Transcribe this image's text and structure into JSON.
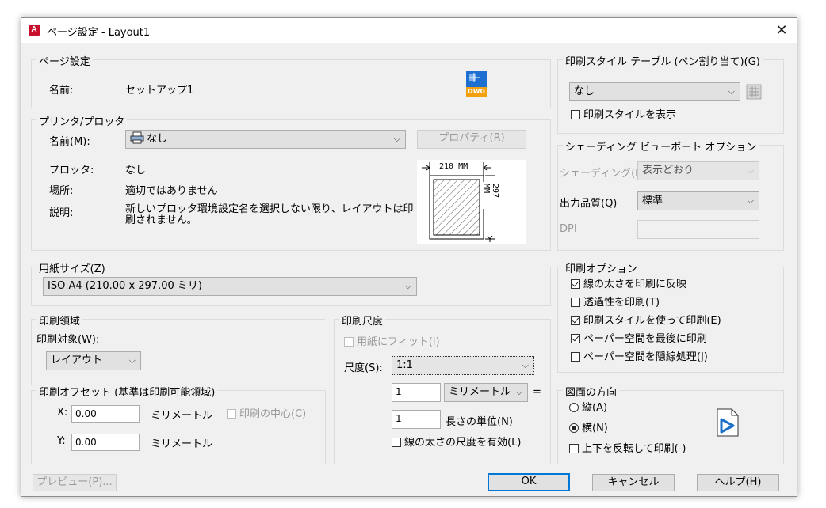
{
  "window": {
    "title": "ページ設定 - Layout1",
    "app_icon": "A"
  },
  "page_setup": {
    "group": "ページ設定",
    "name_label": "名前:",
    "name_value": "セットアップ1",
    "dwg_icon_text": "DWG"
  },
  "printer": {
    "group": "プリンタ/プロッタ",
    "name_label": "名前(M):",
    "name_value": "なし",
    "properties_button": "プロパティ(R)",
    "plotter_label": "プロッタ:",
    "plotter_value": "なし",
    "location_label": "場所:",
    "location_value": "適切ではありません",
    "description_label": "説明:",
    "description_value": "新しいプロッタ環境設定名を選択しない限り、レイアウトは印刷されません。",
    "preview_width": "210 MM",
    "preview_height": "297 MM"
  },
  "paper_size": {
    "group": "用紙サイズ(Z)",
    "value": "ISO A4 (210.00 x 297.00 ミリ)"
  },
  "plot_area": {
    "group": "印刷領域",
    "what_label": "印刷対象(W):",
    "what_value": "レイアウト"
  },
  "plot_offset": {
    "group": "印刷オフセット (基準は印刷可能領域)",
    "x_label": "X:",
    "x_value": "0.00",
    "x_unit": "ミリメートル",
    "y_label": "Y:",
    "y_value": "0.00",
    "y_unit": "ミリメートル",
    "center_label": "印刷の中心(C)"
  },
  "plot_scale": {
    "group": "印刷尺度",
    "fit_label": "用紙にフィット(I)",
    "scale_label": "尺度(S):",
    "scale_value": "1:1",
    "units_value": "1",
    "units_unit": "ミリメートル",
    "equals": "=",
    "drawing_units_value": "1",
    "drawing_units_label": "長さの単位(N)",
    "scale_lineweights_label": "線の太さの尺度を有効(L)"
  },
  "plot_style_table": {
    "group": "印刷スタイル テーブル (ペン割り当て)(G)",
    "value": "なし",
    "display_label": "印刷スタイルを表示"
  },
  "shaded_viewport": {
    "group": "シェーディング ビューポート オプション",
    "shade_label": "シェーディング(D)",
    "shade_value": "表示どおり",
    "quality_label": "出力品質(Q)",
    "quality_value": "標準",
    "dpi_label": "DPI"
  },
  "plot_options": {
    "group": "印刷オプション",
    "items": [
      {
        "label": "線の太さを印刷に反映",
        "checked": true
      },
      {
        "label": "透過性を印刷(T)",
        "checked": false
      },
      {
        "label": "印刷スタイルを使って印刷(E)",
        "checked": true
      },
      {
        "label": "ペーパー空間を最後に印刷",
        "checked": true
      },
      {
        "label": "ペーパー空間を隠線処理(J)",
        "checked": false
      }
    ]
  },
  "orientation": {
    "group": "図面の方向",
    "portrait": "縦(A)",
    "landscape": "横(N)",
    "upside_down": "上下を反転して印刷(-)"
  },
  "buttons": {
    "preview": "プレビュー(P)...",
    "ok": "OK",
    "cancel": "キャンセル",
    "help": "ヘルプ(H)"
  }
}
